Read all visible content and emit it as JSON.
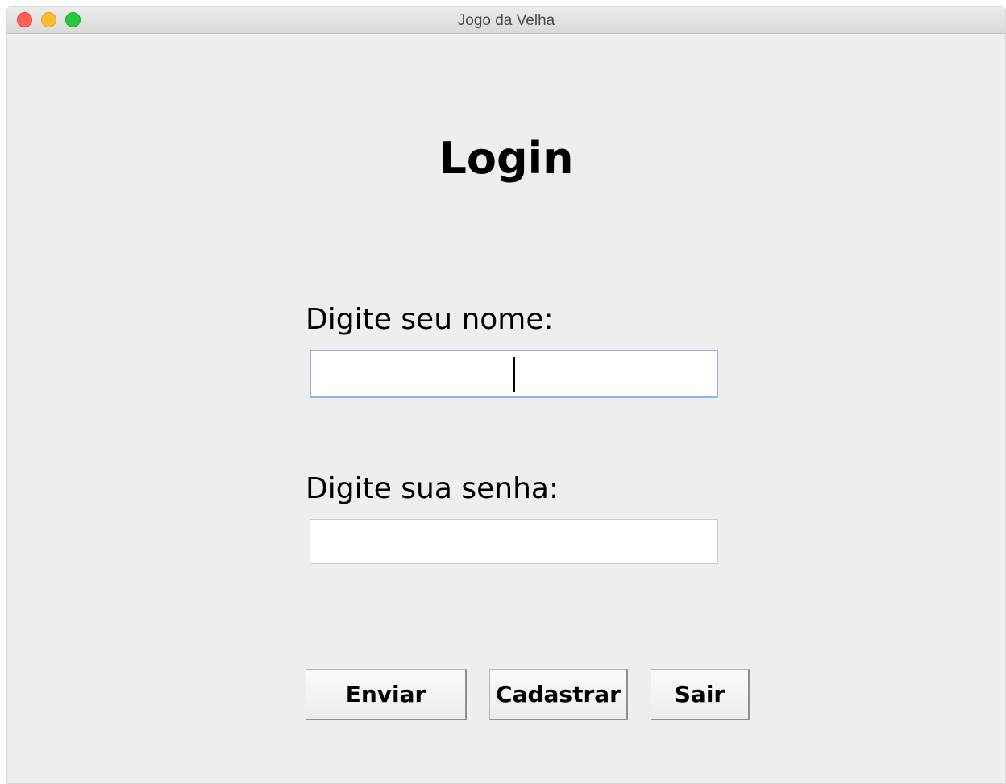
{
  "window": {
    "title": "Jogo da Velha"
  },
  "login": {
    "heading": "Login",
    "name_label": "Digite seu nome:",
    "name_value": "",
    "password_label": "Digite sua senha:",
    "password_value": ""
  },
  "buttons": {
    "enviar": "Enviar",
    "cadastrar": "Cadastrar",
    "sair": "Sair"
  },
  "colors": {
    "window_bg": "#eeeeee",
    "focus_border": "#8fb6ea",
    "close": "#fe5f57",
    "minimize": "#febc2e",
    "maximize": "#28c840"
  },
  "icons": {
    "close": "close-dot-icon",
    "minimize": "minimize-dot-icon",
    "maximize": "zoom-dot-icon"
  }
}
